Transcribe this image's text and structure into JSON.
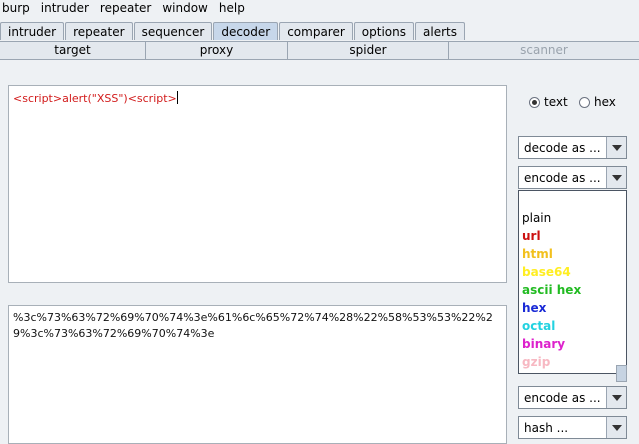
{
  "menu": [
    "burp",
    "intruder",
    "repeater",
    "window",
    "help"
  ],
  "tabs_row1": [
    {
      "label": "intruder",
      "selected": false
    },
    {
      "label": "repeater",
      "selected": false
    },
    {
      "label": "sequencer",
      "selected": false
    },
    {
      "label": "decoder",
      "selected": true
    },
    {
      "label": "comparer",
      "selected": false
    },
    {
      "label": "options",
      "selected": false
    },
    {
      "label": "alerts",
      "selected": false
    }
  ],
  "tabs_row2": [
    {
      "label": "target",
      "disabled": false
    },
    {
      "label": "proxy",
      "disabled": false
    },
    {
      "label": "spider",
      "disabled": false
    },
    {
      "label": "scanner",
      "disabled": true
    }
  ],
  "decoder": {
    "input_text": "<script>alert(\"XSS\")<script>",
    "output_text": "%3c%73%63%72%69%70%74%3e%61%6c%65%72%74%28%22%58%53%53%22%29%3c%73%63%72%69%70%74%3e",
    "format": {
      "text_label": "text",
      "hex_label": "hex",
      "selected": "text"
    },
    "decode_combo": "decode as ...",
    "encode_combo": "encode as ...",
    "encode_combo_bottom": "encode as ...",
    "hash_combo": "hash ...",
    "dropdown_items": [
      {
        "label": "encode as ...",
        "color": "#ffffff"
      },
      {
        "label": "plain",
        "color": "#000000"
      },
      {
        "label": "url",
        "color": "#cc1111"
      },
      {
        "label": "html",
        "color": "#f2c01e"
      },
      {
        "label": "base64",
        "color": "#ffee22"
      },
      {
        "label": "ascii hex",
        "color": "#22bb22"
      },
      {
        "label": "hex",
        "color": "#1a2ad6"
      },
      {
        "label": "octal",
        "color": "#22d2e0"
      },
      {
        "label": "binary",
        "color": "#dd22cc"
      },
      {
        "label": "gzip",
        "color": "#f7b8c2"
      }
    ]
  }
}
